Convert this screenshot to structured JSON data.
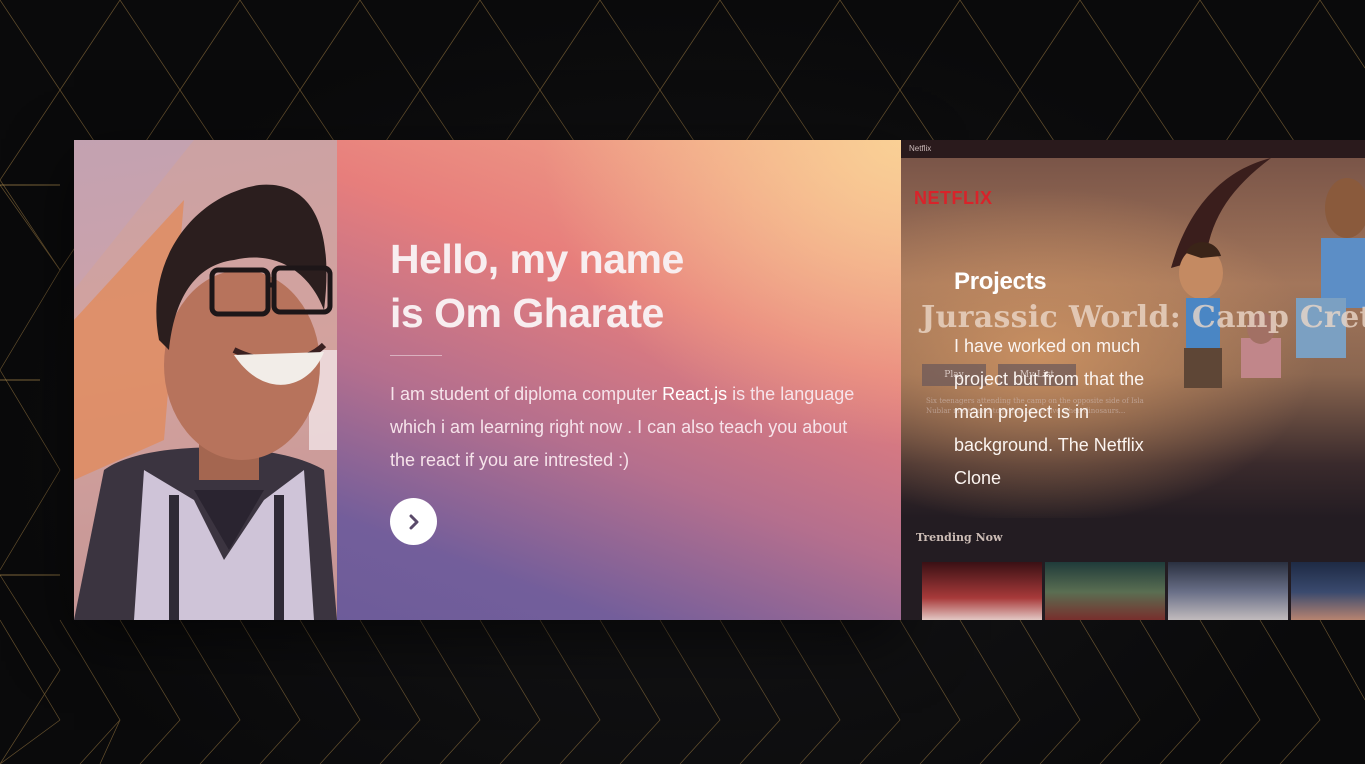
{
  "profile": {
    "title_line1": "Hello, my name",
    "title_line2": "is Om Gharate",
    "bio_before": "I am student of diploma computer ",
    "bio_highlight": "React.js",
    "bio_after": " is the language which i am learning right now . I can also teach you about the react if you are intrested :)",
    "next_icon": "chevron-right-icon"
  },
  "project": {
    "window_title": "Netflix",
    "brand": "NETFLIX",
    "movie_title": "Jurassic World: Camp Cretaceous",
    "play_label": "Play",
    "list_label": "My List",
    "movie_description": "Six teenagers attending the camp on the opposite side of Isla Nublar must band together to survive when dinosaurs...",
    "heading": "Projects",
    "body": "I have worked on much project but from that the main project is in background. The Netflix Clone",
    "row_title": "Trending Now"
  },
  "colors": {
    "accent_gold": "#c9a25a",
    "netflix_red": "#d8232a",
    "card_gradient_start": "#f2a98a",
    "card_gradient_end": "#6d5c9a"
  }
}
